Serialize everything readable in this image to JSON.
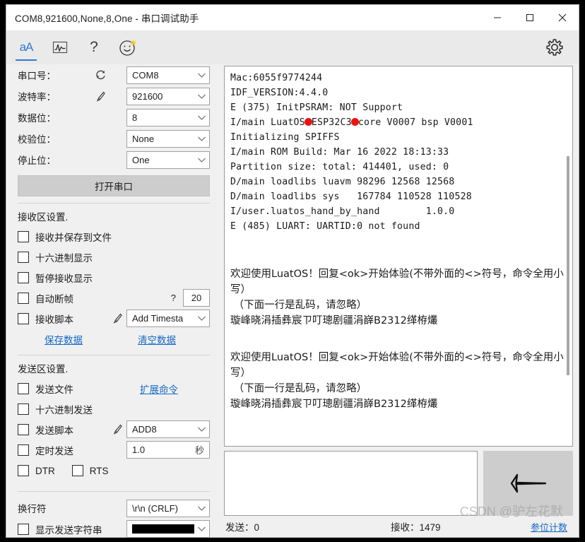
{
  "window": {
    "title": "COM8,921600,None,8,One - 串口调试助手",
    "minimize_label": "—",
    "maximize_label": "□",
    "close_label": "✕"
  },
  "toolbar": {
    "items": [
      {
        "name": "font-icon",
        "label": "aA"
      },
      {
        "name": "waveform-icon",
        "label": ""
      },
      {
        "name": "help-icon",
        "label": "?"
      },
      {
        "name": "smiley-icon",
        "label": ""
      }
    ],
    "settings_label": ""
  },
  "serial_settings": {
    "port_label": "串口号：",
    "port_value": "COM8",
    "baud_label": "波特率：",
    "baud_value": "921600",
    "databits_label": "数据位：",
    "databits_value": "8",
    "parity_label": "校验位：",
    "parity_value": "None",
    "stopbits_label": "停止位：",
    "stopbits_value": "One",
    "open_button": "打开串口"
  },
  "receive_settings": {
    "section_title": "接收区设置.",
    "save_to_file": "接收并保存到文件",
    "hex_display": "十六进制显示",
    "pause_display": "暂停接收显示",
    "auto_frame": "自动断帧",
    "auto_frame_help": "?",
    "auto_frame_value": "20",
    "recv_script": "接收脚本",
    "recv_script_value": "Add Timesta",
    "save_data_link": "保存数据",
    "clear_data_link": "清空数据"
  },
  "send_settings": {
    "section_title": "发送区设置.",
    "send_file": "发送文件",
    "extend_cmd_link": "扩展命令",
    "hex_send": "十六进制发送",
    "send_script": "发送脚本",
    "send_script_value": "ADD8",
    "timed_send": "定时发送",
    "timed_value": "1.0",
    "timed_unit": "秒",
    "dtr": "DTR",
    "rts": "RTS"
  },
  "line_settings": {
    "newline_label": "换行符",
    "newline_value": "\\r\\n (CRLF)",
    "show_send_string": "显示发送字符串",
    "color_value": "#000000"
  },
  "terminal": {
    "lines": [
      "Mac:6055f9774244",
      "IDF_VERSION:4.4.0",
      "E (375) InitPSRAM: NOT Support",
      "I/main ROM Build: Mar 16 2022 18:13:33",
      "Partition size: total: 414401, used: 0",
      "D/main loadlibs luavm 98296 12568 12568",
      "D/main loadlibs sys   167784 110528 110528",
      "I/user.luatos_hand_by_hand        1.0.0",
      "E (485) LUART: UARTID:0 not found"
    ],
    "annotated_line": {
      "prefix": "I/main LuatOS",
      "middle": "ESP32C3",
      "suffix": "core V0007 bsp V0001"
    },
    "initializing_line": "Initializing SPIFFS",
    "block_a": "欢迎使用LuatOS！回复<ok>开始体验(不带外面的<>符号，命令全用小写）\n （下面一行是乱码，请忽略）\n璇峰晓涓插彝宸ㄗ叮璁剧疆涓嶭B2312缂栫爜",
    "block_b": "欢迎使用LuatOS！回复<ok>开始体验(不带外面的<>符号，命令全用小写）\n （下面一行是乱码，请忽略）\n璇峰晓涓插彝宸ㄗ叮璁剧疆涓嶭B2312缂栫爜"
  },
  "send_area": {
    "input_value": "",
    "send_button_label": ""
  },
  "status": {
    "sent_label": "发送：0",
    "recv_label": "接收：1479",
    "count_link": "参位计数",
    "watermark": "CSDN @驴左花默"
  },
  "colors": {
    "accent": "#2e7bd4",
    "link": "#1569c7",
    "annotation": "#ee1111",
    "button_face": "#cdcdcd",
    "panel": "#f0f0f0"
  }
}
